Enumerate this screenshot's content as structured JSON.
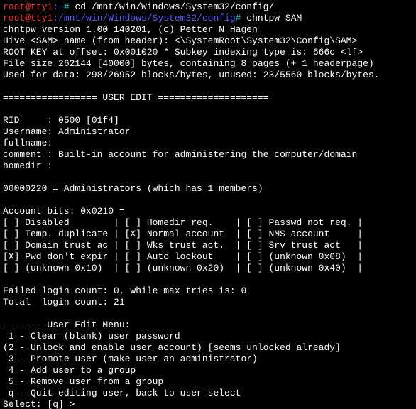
{
  "line1": {
    "prompt": "root@tty1",
    "path": ":~",
    "hash": "# ",
    "cmd": "cd /mnt/win/Windows/System32/config/"
  },
  "line2": {
    "prompt": "root@tty1",
    "path": ":/mnt/win/Windows/System32/config",
    "hash": "# ",
    "cmd": "chntpw SAM"
  },
  "out": {
    "l3": "chntpw version 1.00 140201, (c) Petter N Hagen",
    "l4": "Hive <SAM> name (from header): <\\SystemRoot\\System32\\Config\\SAM>",
    "l5": "ROOT KEY at offset: 0x001020 * Subkey indexing type is: 666c <lf>",
    "l6": "File size 262144 [40000] bytes, containing 8 pages (+ 1 headerpage)",
    "l7": "Used for data: 298/26952 blocks/bytes, unused: 23/5560 blocks/bytes.",
    "l8": "",
    "l9": "================= USER EDIT ====================",
    "l10": "",
    "l11": "RID     : 0500 [01f4]",
    "l12": "Username: Administrator",
    "l13": "fullname:",
    "l14": "comment : Built-in account for administering the computer/domain",
    "l15": "homedir :",
    "l16": "",
    "l17": "00000220 = Administrators (which has 1 members)",
    "l18": "",
    "l19": "Account bits: 0x0210 =",
    "l20": "[ ] Disabled        | [ ] Homedir req.    | [ ] Passwd not req. |",
    "l21": "[ ] Temp. duplicate | [X] Normal account  | [ ] NMS account     |",
    "l22": "[ ] Domain trust ac | [ ] Wks trust act.  | [ ] Srv trust act   |",
    "l23": "[X] Pwd don't expir | [ ] Auto lockout    | [ ] (unknown 0x08)  |",
    "l24": "[ ] (unknown 0x10)  | [ ] (unknown 0x20)  | [ ] (unknown 0x40)  |",
    "l25": "",
    "l26": "Failed login count: 0, while max tries is: 0",
    "l27": "Total  login count: 21",
    "l28": "",
    "l29": "- - - - User Edit Menu:",
    "l30": " 1 - Clear (blank) user password",
    "l31": "(2 - Unlock and enable user account) [seems unlocked already]",
    "l32": " 3 - Promote user (make user an administrator)",
    "l33": " 4 - Add user to a group",
    "l34": " 5 - Remove user from a group",
    "l35": " q - Quit editing user, back to user select",
    "l36": "Select: [q] > "
  }
}
